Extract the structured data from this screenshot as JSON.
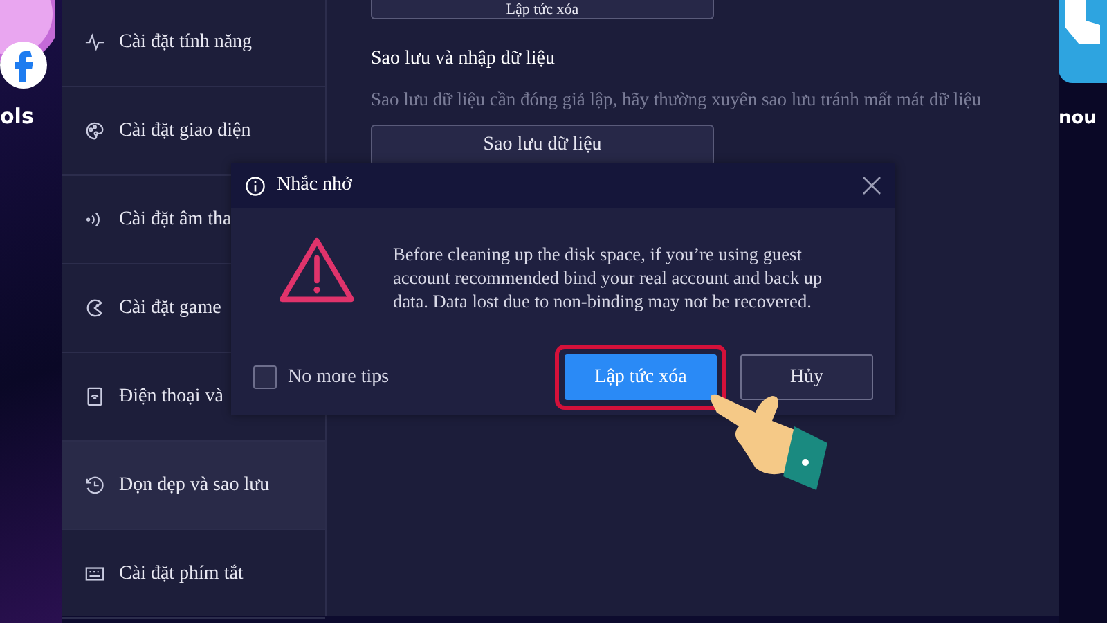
{
  "desktop": {
    "left_label": "ols",
    "right_label": "nou"
  },
  "sidebar": {
    "items": [
      {
        "label": "Cài đặt tính năng",
        "selected": false
      },
      {
        "label": "Cài đặt giao diện",
        "selected": false
      },
      {
        "label": "Cài đặt âm tha",
        "selected": false
      },
      {
        "label": "Cài đặt game",
        "selected": false
      },
      {
        "label": "Điện thoại và",
        "selected": false
      },
      {
        "label": "Dọn dẹp và sao lưu",
        "selected": true
      },
      {
        "label": "Cài đặt phím tắt",
        "selected": false
      }
    ]
  },
  "content": {
    "top_button": "Lập tức xóa",
    "section_title": "Sao lưu và nhập dữ liệu",
    "section_description": "Sao lưu dữ liệu cần đóng giả lập, hãy thường xuyên sao lưu tránh mất mát dữ liệu",
    "backup_button": "Sao lưu dữ liệu"
  },
  "dialog": {
    "title": "Nhắc nhở",
    "message": "Before cleaning up the disk space, if you’re using guest account recommended bind your real account and back up data. Data lost due to non-binding may not be recovered.",
    "checkbox": {
      "label": "No more tips",
      "checked": false
    },
    "confirm_button": "Lập tức xóa",
    "cancel_button": "Hủy"
  }
}
